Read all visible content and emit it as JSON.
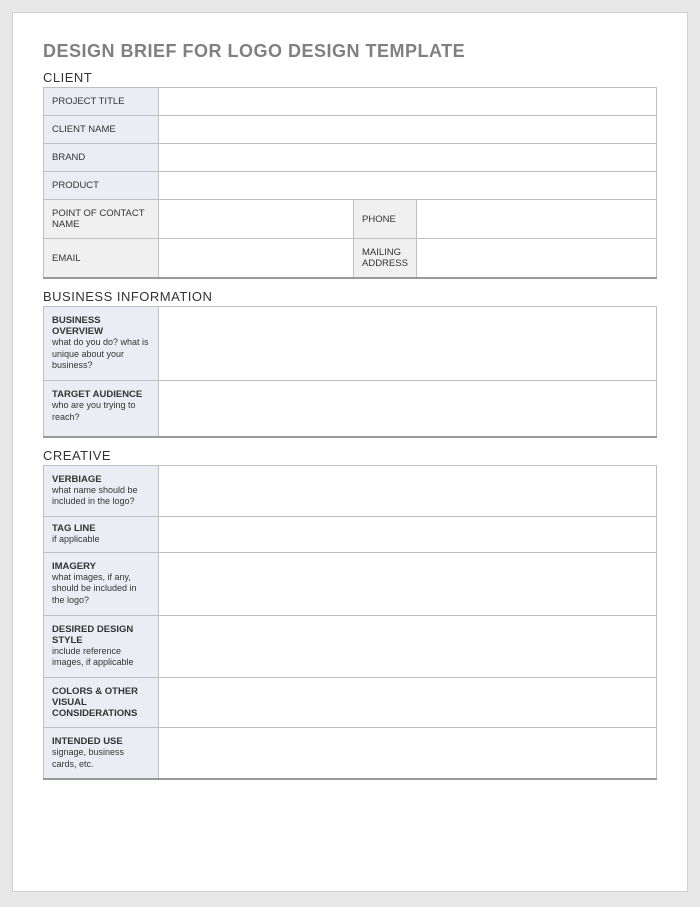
{
  "title": "DESIGN BRIEF FOR LOGO DESIGN TEMPLATE",
  "sections": {
    "client": {
      "heading": "CLIENT",
      "rows": {
        "project_title": "PROJECT TITLE",
        "client_name": "CLIENT NAME",
        "brand": "BRAND",
        "product": "PRODUCT",
        "poc": "POINT OF CONTACT NAME",
        "phone": "PHONE",
        "email": "EMAIL",
        "mailing": "MAILING ADDRESS"
      },
      "values": {
        "project_title": "",
        "client_name": "",
        "brand": "",
        "product": "",
        "poc": "",
        "phone": "",
        "email": "",
        "mailing": ""
      }
    },
    "business": {
      "heading": "BUSINESS INFORMATION",
      "overview": {
        "label": "BUSINESS OVERVIEW",
        "sub": "what do you do? what is unique about your business?",
        "value": ""
      },
      "audience": {
        "label": "TARGET AUDIENCE",
        "sub": "who are you trying to reach?",
        "value": ""
      }
    },
    "creative": {
      "heading": "CREATIVE",
      "verbiage": {
        "label": "VERBIAGE",
        "sub": "what name should be included in the logo?",
        "value": ""
      },
      "tagline": {
        "label": "TAG LINE",
        "sub": "if applicable",
        "value": ""
      },
      "imagery": {
        "label": "IMAGERY",
        "sub": "what images, if any, should be included in the logo?",
        "value": ""
      },
      "style": {
        "label": "DESIRED DESIGN STYLE",
        "sub": "include reference images, if applicable",
        "value": ""
      },
      "colors": {
        "label": "COLORS & OTHER VISUAL CONSIDERATIONS",
        "sub": "",
        "value": ""
      },
      "use": {
        "label": "INTENDED USE",
        "sub": "signage, business cards, etc.",
        "value": ""
      }
    }
  }
}
